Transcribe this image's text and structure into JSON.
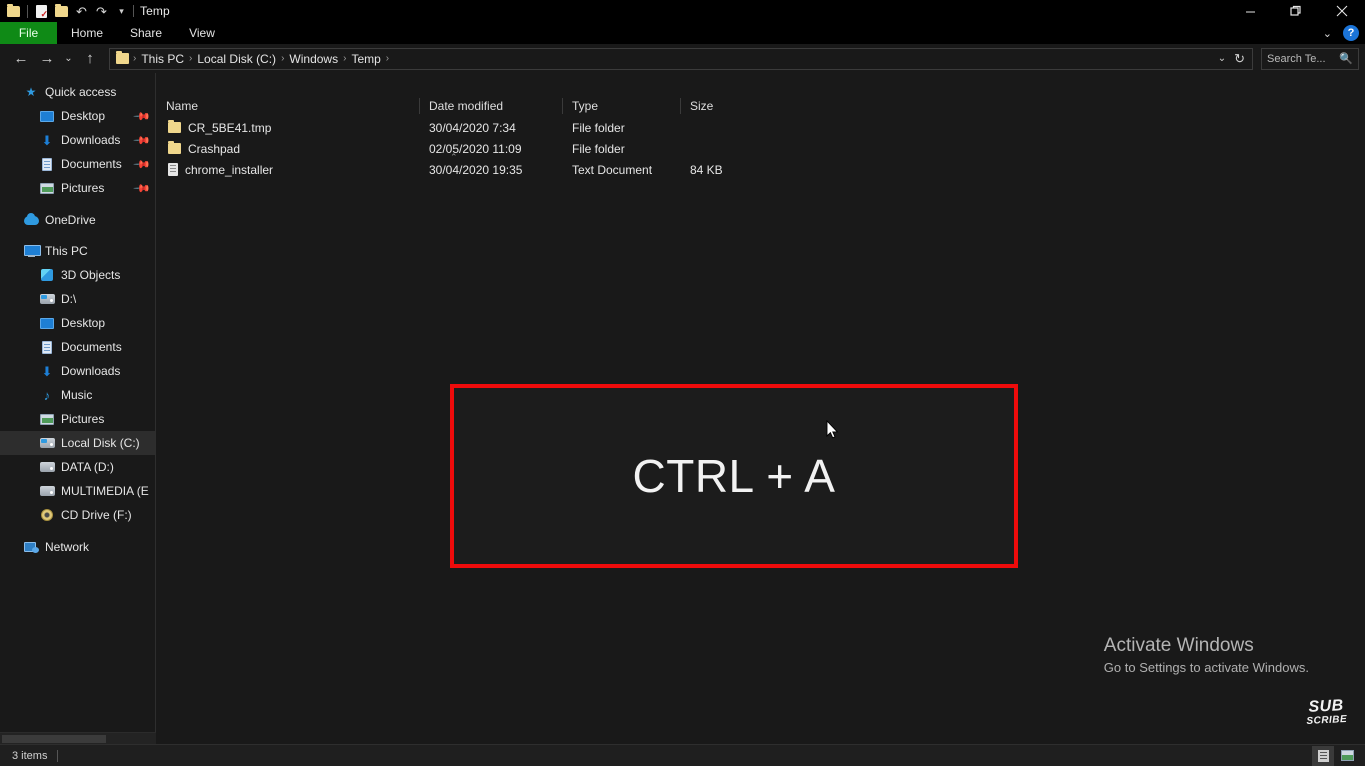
{
  "window": {
    "title": "Temp",
    "quick_access": [
      "folder-icon",
      "properties-icon",
      "new-folder-icon",
      "undo-icon",
      "redo-icon",
      "customize-chevron-icon"
    ],
    "controls": {
      "minimize": "minimize-icon",
      "restore": "restore-icon",
      "close": "close-icon",
      "collapse_ribbon": "chevron-down-icon",
      "help": "?"
    }
  },
  "ribbon": {
    "tabs": [
      {
        "label": "File",
        "active": true,
        "color": "#0f8a16"
      },
      {
        "label": "Home",
        "active": false
      },
      {
        "label": "Share",
        "active": false
      },
      {
        "label": "View",
        "active": false
      }
    ]
  },
  "address": {
    "back": "back-arrow-icon",
    "forward": "forward-arrow-icon",
    "recent": "chevron-down-icon",
    "up": "up-arrow-icon",
    "breadcrumbs": [
      "This PC",
      "Local Disk (C:)",
      "Windows",
      "Temp"
    ],
    "separator": "›",
    "history_chevron": "chevron-down-icon",
    "refresh": "refresh-icon"
  },
  "search": {
    "placeholder": "Search Te...",
    "value": "",
    "icon": "search-icon"
  },
  "sidebar": {
    "items": [
      {
        "label": "Quick access",
        "icon": "star-icon",
        "level": 0,
        "pinned": false,
        "selected": false
      },
      {
        "label": "Desktop",
        "icon": "desktop-icon",
        "level": 1,
        "pinned": true,
        "selected": false
      },
      {
        "label": "Downloads",
        "icon": "downloads-icon",
        "level": 1,
        "pinned": true,
        "selected": false
      },
      {
        "label": "Documents",
        "icon": "documents-icon",
        "level": 1,
        "pinned": true,
        "selected": false
      },
      {
        "label": "Pictures",
        "icon": "pictures-icon",
        "level": 1,
        "pinned": true,
        "selected": false
      },
      {
        "label": "OneDrive",
        "icon": "cloud-icon",
        "level": 0,
        "pinned": false,
        "selected": false
      },
      {
        "label": "This PC",
        "icon": "pc-icon",
        "level": 0,
        "pinned": false,
        "selected": false
      },
      {
        "label": "3D Objects",
        "icon": "3d-objects-icon",
        "level": 1,
        "pinned": false,
        "selected": false
      },
      {
        "label": "D:\\",
        "icon": "drive-icon",
        "level": 1,
        "pinned": false,
        "selected": false
      },
      {
        "label": "Desktop",
        "icon": "desktop-icon",
        "level": 1,
        "pinned": false,
        "selected": false
      },
      {
        "label": "Documents",
        "icon": "documents-icon",
        "level": 1,
        "pinned": false,
        "selected": false
      },
      {
        "label": "Downloads",
        "icon": "downloads-icon",
        "level": 1,
        "pinned": false,
        "selected": false
      },
      {
        "label": "Music",
        "icon": "music-icon",
        "level": 1,
        "pinned": false,
        "selected": false
      },
      {
        "label": "Pictures",
        "icon": "pictures-icon",
        "level": 1,
        "pinned": false,
        "selected": false
      },
      {
        "label": "Local Disk (C:)",
        "icon": "drive-icon",
        "level": 1,
        "pinned": false,
        "selected": true
      },
      {
        "label": "DATA (D:)",
        "icon": "drive-icon",
        "level": 1,
        "pinned": false,
        "selected": false
      },
      {
        "label": "MULTIMEDIA (E:)",
        "icon": "drive-icon",
        "level": 1,
        "pinned": false,
        "selected": false
      },
      {
        "label": "CD Drive (F:)",
        "icon": "cd-drive-icon",
        "level": 1,
        "pinned": false,
        "selected": false
      },
      {
        "label": "Network",
        "icon": "network-icon",
        "level": 0,
        "pinned": false,
        "selected": false
      }
    ]
  },
  "file_list": {
    "sort_column": "Name",
    "sort_direction": "ascending",
    "columns": [
      "Name",
      "Date modified",
      "Type",
      "Size"
    ],
    "rows": [
      {
        "name": "CR_5BE41.tmp",
        "date": "30/04/2020 7:34",
        "type": "File folder",
        "size": "",
        "icon": "folder-icon"
      },
      {
        "name": "Crashpad",
        "date": "02/05/2020 11:09",
        "type": "File folder",
        "size": "",
        "icon": "folder-icon"
      },
      {
        "name": "chrome_installer",
        "date": "30/04/2020 19:35",
        "type": "Text Document",
        "size": "84 KB",
        "icon": "text-document-icon"
      }
    ]
  },
  "overlay": {
    "text": "CTRL + A",
    "border_color": "#ee0b0b"
  },
  "watermark": {
    "line1": "Activate Windows",
    "line2": "Go to Settings to activate Windows."
  },
  "subscribe": {
    "line1": "SUB",
    "line2": "SCRIBE"
  },
  "statusbar": {
    "items_text": "3 items",
    "view_details": "details-view-icon",
    "view_large_icons": "large-icons-view-icon"
  }
}
